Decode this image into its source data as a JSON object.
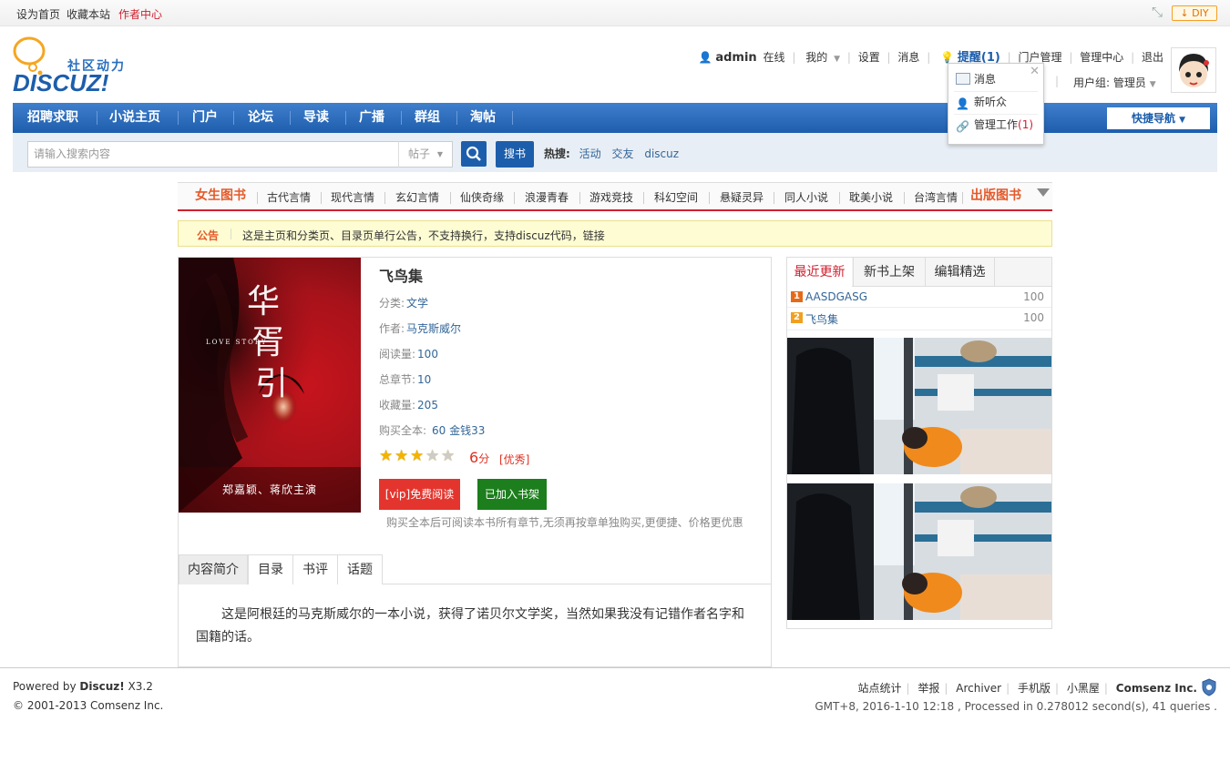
{
  "topbar": {
    "set_home": "设为首页",
    "bookmark": "收藏本站",
    "author_center": "作者中心",
    "diy": "DIY"
  },
  "logo": {
    "tagline": "社区动力",
    "wordmark": "DISCUZ!"
  },
  "userbar": {
    "username": "admin",
    "status": "在线",
    "mine": "我的",
    "settings": "设置",
    "messages": "消息",
    "reminder": "提醒(1)",
    "portal_admin": "门户管理",
    "admin_center": "管理中心",
    "logout": "退出",
    "user_group": "用户组: 管理员"
  },
  "popup": {
    "items": [
      "消息",
      "新听众",
      "管理工作"
    ],
    "work_count": "(1)"
  },
  "nav": {
    "items": [
      "招聘求职",
      "小说主页",
      "门户",
      "论坛",
      "导读",
      "广播",
      "群组",
      "淘帖"
    ],
    "quick_nav": "快捷导航"
  },
  "search": {
    "placeholder": "请输入搜索内容",
    "type": "帖子",
    "button": "搜书",
    "hot_label": "热搜:",
    "hot": [
      "活动",
      "交友",
      "discuz"
    ]
  },
  "categories": {
    "left_title": "女生图书",
    "items": [
      "古代言情",
      "现代言情",
      "玄幻言情",
      "仙侠奇缘",
      "浪漫青春",
      "游戏竞技",
      "科幻空间",
      "悬疑灵异",
      "同人小说",
      "耽美小说",
      "台湾言情"
    ],
    "right_title": "出版图书"
  },
  "notice": {
    "label": "公告",
    "text": "这是主页和分类页、目录页单行公告，不支持换行，支持discuz代码，链接"
  },
  "book": {
    "title": "飞鸟集",
    "category_label": "分类:",
    "category": "文学",
    "author_label": "作者:",
    "author": "马克斯威尔",
    "reads_label": "阅读量:",
    "reads": "100",
    "chapters_label": "总章节:",
    "chapters": "10",
    "favorites_label": "收藏量:",
    "favorites": "205",
    "price_label": "购买全本:",
    "price": "60 金钱33",
    "rating_stars": 3,
    "score": "6",
    "score_unit": "分",
    "level": "[优秀]",
    "vip_button": "[vip]免费阅读",
    "shelf_button": "已加入书架",
    "buy_note": "购买全本后可阅读本书所有章节,无须再按章单独购买,更便捷、价格更优惠",
    "cover_text": {
      "en": "LOVE      STORY",
      "cast": "郑嘉颖、蒋欣主演"
    }
  },
  "tabs": [
    "内容简介",
    "目录",
    "书评",
    "话题"
  ],
  "intro": "这是阿根廷的马克斯威尔的一本小说，获得了诺贝尔文学奖，当然如果我没有记错作者名字和国籍的话。",
  "right": {
    "tabs": [
      "最近更新",
      "新书上架",
      "编辑精选"
    ],
    "list": [
      {
        "rank": "1",
        "name": "AASDGASG",
        "value": "100"
      },
      {
        "rank": "2",
        "name": "飞鸟集",
        "value": "100"
      }
    ]
  },
  "footer": {
    "powered_prefix": "Powered by ",
    "powered_name": "Discuz!",
    "powered_version": " X3.2",
    "copyright": "© 2001-2013 Comsenz Inc.",
    "links": [
      "站点统计",
      "举报",
      "Archiver",
      "手机版",
      "小黑屋"
    ],
    "company": "Comsenz Inc.",
    "info": "GMT+8, 2016-1-10 12:18 , Processed in 0.278012 second(s), 41 queries ."
  },
  "colors": {
    "nav_blue": "#1d5eac",
    "accent_red": "#d02030",
    "vip_red": "#e3352e",
    "shelf_green": "#1c7e1c"
  }
}
